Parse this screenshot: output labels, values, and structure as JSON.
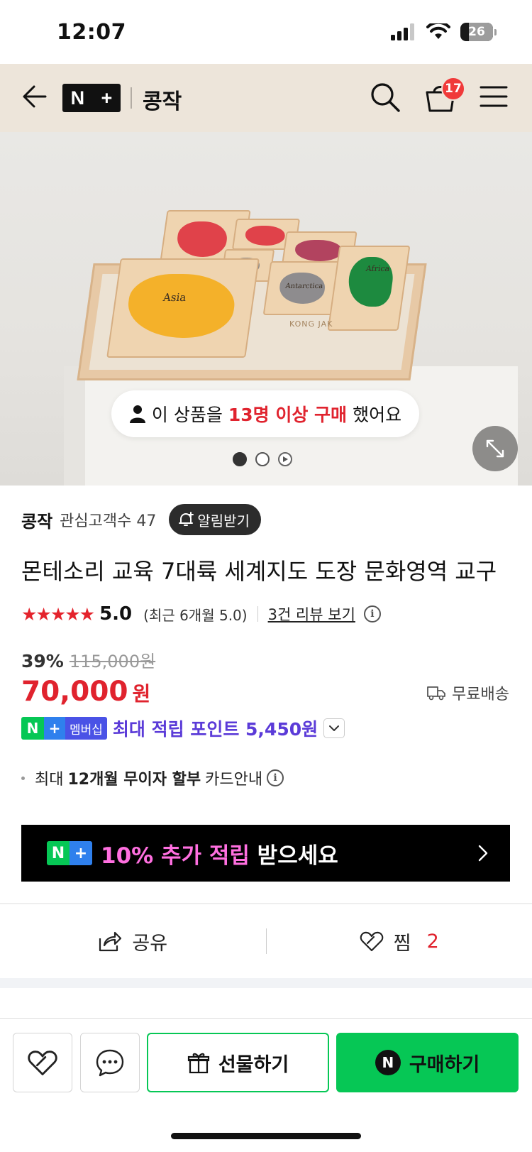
{
  "status_bar": {
    "time": "12:07",
    "battery": "26"
  },
  "header": {
    "logo_n": "N",
    "logo_plus": "+",
    "store_name": "콩작",
    "cart_count": "17"
  },
  "hero": {
    "map_labels": {
      "asia": "Asia",
      "africa": "Africa",
      "antarctica": "Antarctica",
      "brand": "KONG JAK"
    },
    "purchase_prefix": "이 상품을",
    "purchase_highlight": "13명 이상 구매",
    "purchase_suffix": "했어요"
  },
  "seller": {
    "name": "콩작",
    "followers": "관심고객수 47",
    "notify_label": "알림받기"
  },
  "product": {
    "title": "몬테소리 교육 7대륙 세계지도 도장 문화영역 교구",
    "stars": "★★★★★",
    "rating": "5.0",
    "recent_rating": "(최근 6개월 5.0)",
    "review_link": "3건 리뷰 보기",
    "discount_rate": "39%",
    "original_price": "115,000원",
    "price": "70,000",
    "currency": "원",
    "shipping": "무료배송"
  },
  "points": {
    "badge_n": "N",
    "badge_plus": "+",
    "badge_member": "멤버십",
    "text": "최대 적립 포인트 5,450원"
  },
  "installment": {
    "prefix": "최대",
    "bold": "12개월 무이자 할부",
    "suffix": "카드안내"
  },
  "banner": {
    "n": "N",
    "plus": "+",
    "highlight": "10% 추가 적립",
    "rest": "받으세요"
  },
  "actions": {
    "share_label": "공유",
    "jjim_label": "찜",
    "jjim_count": "2"
  },
  "bottom_bar": {
    "gift_label": "선물하기",
    "buy_label": "구매하기",
    "buy_n": "N"
  },
  "colors": {
    "accent_red": "#e0232e",
    "naver_green": "#06c755",
    "header_bg": "#ede5da",
    "point_purple": "#5b3bd8"
  }
}
